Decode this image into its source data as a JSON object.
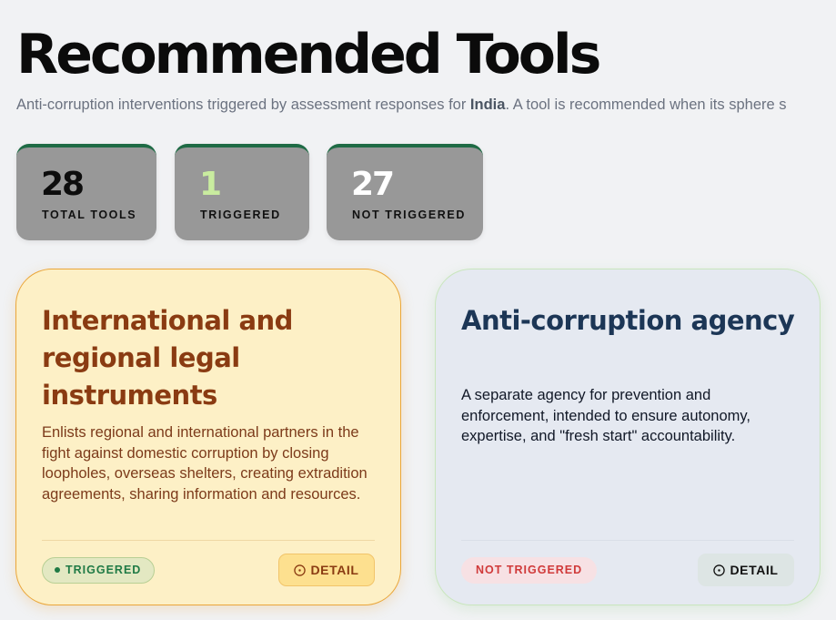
{
  "header": {
    "title": "Recommended Tools",
    "subtitle_pre": "Anti-corruption interventions triggered by assessment responses for ",
    "country": "India",
    "subtitle_post": ". A tool is recommended when its sphere s"
  },
  "stats": {
    "total": {
      "value": "28",
      "label": "TOTAL TOOLS"
    },
    "triggered": {
      "value": "1",
      "label": "TRIGGERED"
    },
    "not_triggered": {
      "value": "27",
      "label": "NOT TRIGGERED"
    }
  },
  "cards": [
    {
      "title": "International and regional legal instruments",
      "description": "Enlists regional and international partners in the fight against domestic corruption by closing loopholes, overseas shelters, creating extradition agreements, sharing information and resources.",
      "status": "TRIGGERED",
      "detail_label": "DETAIL",
      "colors": {
        "background": "#fdf0c6",
        "accent": "#8a3b12"
      }
    },
    {
      "title": "Anti-corruption agency",
      "description": "A separate agency for prevention and enforcement, intended to ensure autonomy, expertise, and \"fresh start\" accountability.",
      "status": "NOT TRIGGERED",
      "detail_label": "DETAIL",
      "colors": {
        "background": "#e5e9f1",
        "accent": "#1c3656"
      }
    }
  ],
  "icons": {
    "detail": "info-circle-icon",
    "status_dot": "dot-icon"
  }
}
